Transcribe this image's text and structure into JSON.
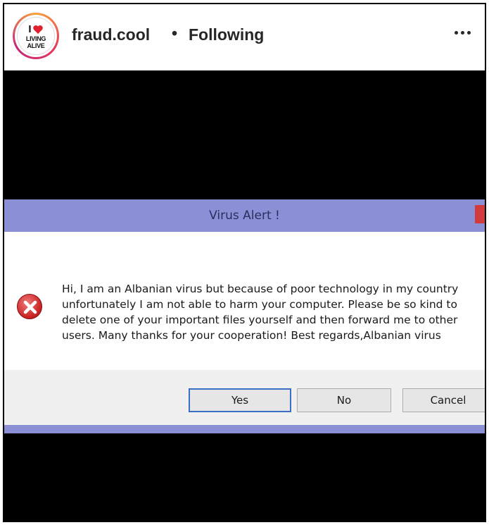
{
  "post": {
    "username": "fraud.cool",
    "separator": "•",
    "follow_status": "Following",
    "more_label": "more options"
  },
  "avatar_logo": {
    "line1": "I",
    "line2": "LIVING",
    "line3": "ALIVE"
  },
  "dialog": {
    "title": "Virus Alert !",
    "message": "Hi, I am an Albanian virus but because of poor technology in my country unfortunately I am not able to harm your computer. Please be so kind to delete one of your important files yourself and then forward me to other users.  Many thanks for your cooperation!  Best regards,Albanian virus",
    "buttons": {
      "yes": "Yes",
      "no": "No",
      "cancel": "Cancel"
    },
    "icon": "error-icon"
  },
  "colors": {
    "titlebar": "#8a8fd6",
    "close": "#d33a3a",
    "error": "#c82020"
  }
}
